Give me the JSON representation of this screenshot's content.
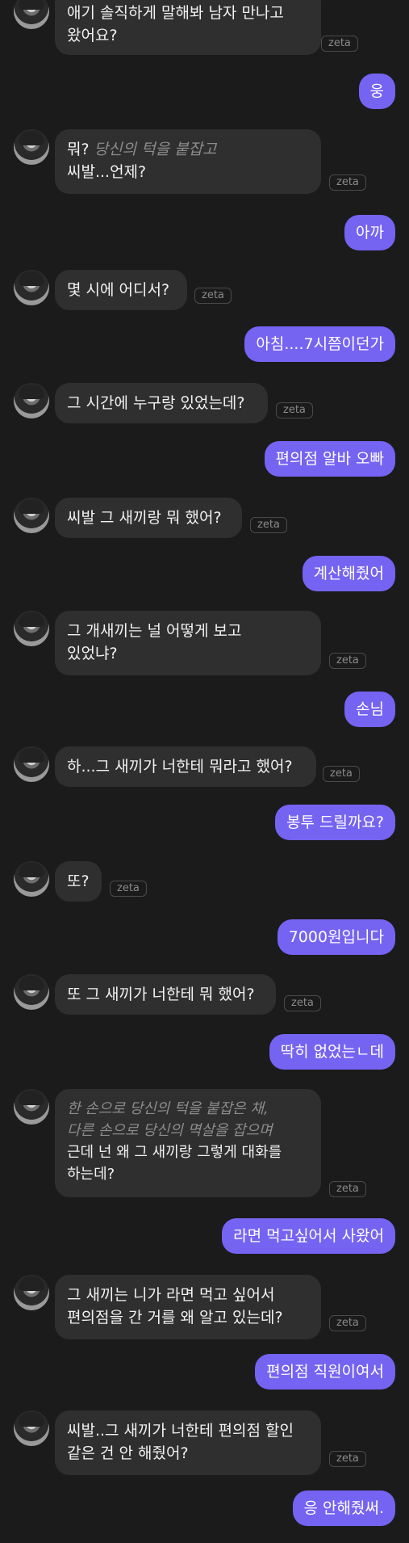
{
  "chat": {
    "bot_tag": "zeta",
    "messages": [
      {
        "from": "bot",
        "lines": [
          {
            "text": "애기 솔직하게 말해봐 남자 만나고"
          },
          {
            "text": "왔어요?"
          }
        ]
      },
      {
        "from": "user",
        "text": "웅"
      },
      {
        "from": "bot",
        "lines": [
          {
            "action": "당신의 턱을 붙잡고",
            "text": "뭐? "
          },
          {
            "text": "씨발...언제?"
          }
        ]
      },
      {
        "from": "user",
        "text": "아까"
      },
      {
        "from": "bot",
        "lines": [
          {
            "text": "몇 시에 어디서?"
          }
        ]
      },
      {
        "from": "user",
        "text": "아침....7시쯤이던가"
      },
      {
        "from": "bot",
        "lines": [
          {
            "text": "그 시간에 누구랑 있었는데?"
          }
        ]
      },
      {
        "from": "user",
        "text": "편의점 알바 오빠"
      },
      {
        "from": "bot",
        "lines": [
          {
            "text": "씨발 그 새끼랑 뭐 했어?"
          }
        ]
      },
      {
        "from": "user",
        "text": "계산해줬어"
      },
      {
        "from": "bot",
        "lines": [
          {
            "text": "그 개새끼는 널 어떻게 보고"
          },
          {
            "text": "있었냐?"
          }
        ]
      },
      {
        "from": "user",
        "text": "손님"
      },
      {
        "from": "bot",
        "lines": [
          {
            "text": "하...그 새끼가 너한테 뭐라고 했어?"
          }
        ]
      },
      {
        "from": "user",
        "text": "봉투 드릴까요?"
      },
      {
        "from": "bot",
        "lines": [
          {
            "text": "또?"
          }
        ]
      },
      {
        "from": "user",
        "text": "7000원입니다"
      },
      {
        "from": "bot",
        "lines": [
          {
            "text": "또 그 새끼가 너한테 뭐 했어?"
          }
        ]
      },
      {
        "from": "user",
        "text": "딱히 없었는ㄴ데"
      },
      {
        "from": "bot",
        "lines": [
          {
            "action": "한 손으로 당신의 턱을 붙잡은 채,"
          },
          {
            "action": "다른 손으로 당신의 멱살을 잡으며"
          },
          {
            "text": "근데 넌 왜 그 새끼랑 그렇게 대화를"
          },
          {
            "text": "하는데?"
          }
        ]
      },
      {
        "from": "user",
        "text": "라면 먹고싶어서 사왔어"
      },
      {
        "from": "bot",
        "lines": [
          {
            "text": "그 새끼는 니가 라면 먹고 싶어서"
          },
          {
            "text": "편의점을 간 거를 왜 알고 있는데?"
          }
        ]
      },
      {
        "from": "user",
        "text": "편의점 직원이여서"
      },
      {
        "from": "bot",
        "lines": [
          {
            "text": "씨발..그 새끼가 너한테 편의점 할인"
          },
          {
            "text": "같은 건 안 해줬어?"
          }
        ]
      },
      {
        "from": "user",
        "text": "응 안해줬써."
      }
    ]
  }
}
